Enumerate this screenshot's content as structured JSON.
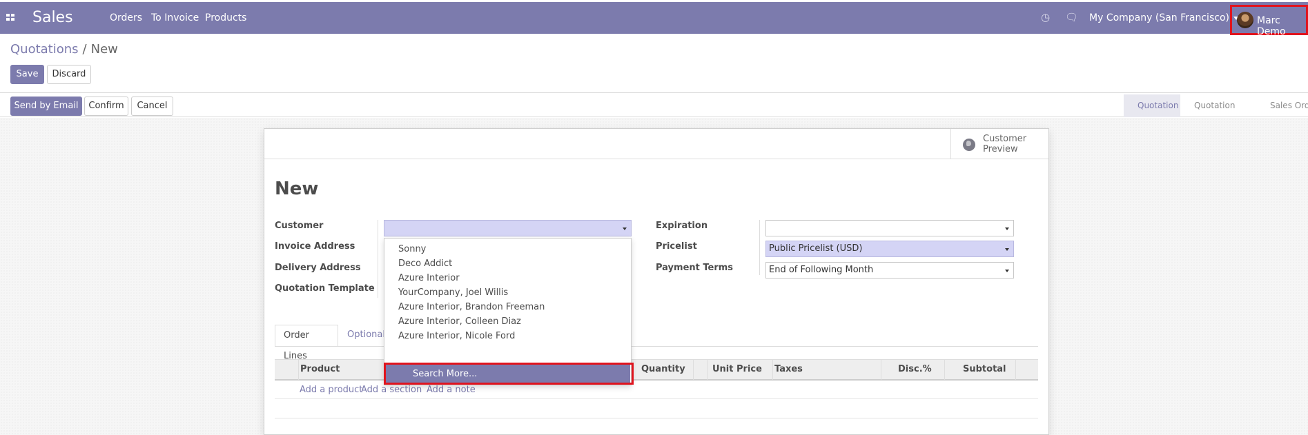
{
  "navbar": {
    "app_name": "Sales",
    "menu": [
      "Orders",
      "To Invoice",
      "Products"
    ],
    "company": "My Company (San Francisco)",
    "user": "Marc Demo",
    "icons": [
      "apps-icon",
      "clock-icon",
      "chat-icon"
    ]
  },
  "breadcrumb": {
    "parent": "Quotations",
    "separator": "/",
    "current": "New"
  },
  "buttons": {
    "save": "Save",
    "discard": "Discard",
    "send_email": "Send by Email",
    "confirm": "Confirm",
    "cancel": "Cancel"
  },
  "status_steps": [
    "Quotation",
    "Quotation Sent",
    "Sales Orde"
  ],
  "sheet": {
    "preview_label": "Customer Preview",
    "title": "New",
    "left_labels": [
      "Customer",
      "Invoice Address",
      "Delivery Address",
      "Quotation Template"
    ],
    "right_labels": [
      "Expiration",
      "Pricelist",
      "Payment Terms"
    ],
    "fields": {
      "customer": "",
      "expiration": "",
      "pricelist": "Public Pricelist (USD)",
      "payment_terms": "End of Following Month"
    }
  },
  "tabs": [
    "Order Lines",
    "Optional"
  ],
  "table": {
    "columns": [
      "Product",
      "Quantity",
      "Unit Price",
      "Taxes",
      "Disc.%",
      "Subtotal"
    ],
    "actions": [
      "Add a product",
      "Add a section",
      "Add a note"
    ]
  },
  "dropdown": {
    "items": [
      "Sonny",
      "Deco Addict",
      "Azure Interior",
      "YourCompany, Joel Willis",
      "Azure Interior, Brandon Freeman",
      "Azure Interior, Colleen Diaz",
      "Azure Interior, Nicole Ford"
    ],
    "search_more": "Search More..."
  },
  "colors": {
    "brand": "#7c7bad",
    "highlight_field": "#d4d4f5",
    "annotation_red": "#e0141e"
  }
}
